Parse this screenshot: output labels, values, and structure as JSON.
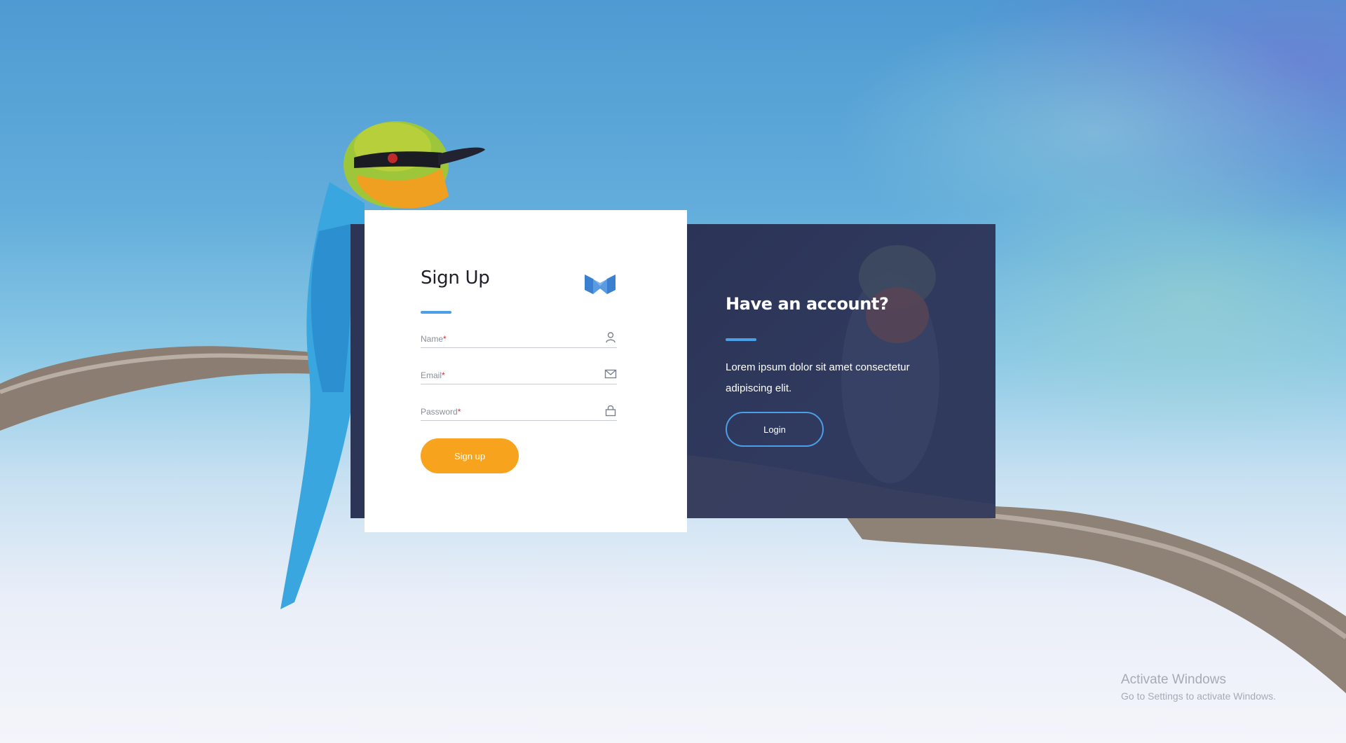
{
  "signup": {
    "title": "Sign Up",
    "fields": [
      {
        "label": "Name",
        "required_mark": "*",
        "icon": "user-icon"
      },
      {
        "label": "Email",
        "required_mark": "*",
        "icon": "mail-icon"
      },
      {
        "label": "Password",
        "required_mark": "*",
        "icon": "lock-icon"
      }
    ],
    "submit_label": "Sign up"
  },
  "account_panel": {
    "heading": "Have an account?",
    "description": "Lorem ipsum dolor sit amet consectetur adipiscing elit.",
    "login_label": "Login"
  },
  "system_overlay": {
    "line1": "Activate Windows",
    "line2": "Go to Settings to activate Windows."
  },
  "colors": {
    "accent_blue": "#4a9fe6",
    "button_orange": "#f8a31e",
    "panel_navy": "#2c3556"
  }
}
